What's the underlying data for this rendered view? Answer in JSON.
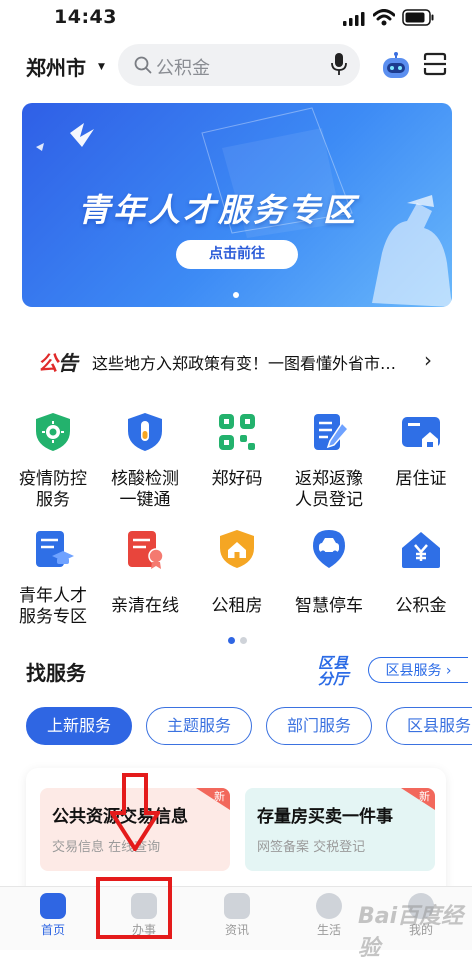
{
  "status_bar": {
    "time": "14:43"
  },
  "header": {
    "city": "郑州市",
    "search_placeholder": "公积金"
  },
  "banner": {
    "title": "青年人才服务专区",
    "button": "点击前往"
  },
  "notice": {
    "tag_a": "公",
    "tag_b": "告",
    "text": "这些地方入郑政策有变！一图看懂外省市…"
  },
  "grid": [
    {
      "line1": "疫情防控",
      "line2": "服务",
      "icon": "virus-shield-icon",
      "color": "#23b26d"
    },
    {
      "line1": "核酸检测",
      "line2": "一键通",
      "icon": "test-tube-shield-icon",
      "color": "#2f6fe6"
    },
    {
      "line1": "郑好码",
      "line2": "",
      "icon": "qr-code-icon",
      "color": "#23b26d"
    },
    {
      "line1": "返郑返豫",
      "line2": "人员登记",
      "icon": "register-pen-icon",
      "color": "#2f6fe6"
    },
    {
      "line1": "居住证",
      "line2": "",
      "icon": "residence-card-icon",
      "color": "#2f6fe6"
    },
    {
      "line1": "青年人才",
      "line2": "服务专区",
      "icon": "graduation-doc-icon",
      "color": "#2f6fe6"
    },
    {
      "line1": "亲清在线",
      "line2": "",
      "icon": "certificate-icon",
      "color": "#e8453c"
    },
    {
      "line1": "公租房",
      "line2": "",
      "icon": "house-shield-icon",
      "color": "#f5a623"
    },
    {
      "line1": "智慧停车",
      "line2": "",
      "icon": "car-location-icon",
      "color": "#2f6fe6"
    },
    {
      "line1": "公积金",
      "line2": "",
      "icon": "yuan-house-icon",
      "color": "#2f6fe6"
    }
  ],
  "services": {
    "title": "找服务",
    "district_logo_a": "区县",
    "district_logo_b": "分厅",
    "district_link": "区县服务 ›",
    "chips": [
      "上新服务",
      "主题服务",
      "部门服务",
      "区县服务"
    ],
    "cards": [
      {
        "title": "公共资源交易信息",
        "sub": "交易信息 在线查询",
        "badge": "新"
      },
      {
        "title": "存量房买卖一件事",
        "sub": "网签备案 交税登记",
        "badge": "新"
      }
    ]
  },
  "tabs": [
    {
      "label": "首页",
      "icon": "home-icon"
    },
    {
      "label": "办事",
      "icon": "clock-icon"
    },
    {
      "label": "资讯",
      "icon": "news-icon"
    },
    {
      "label": "生活",
      "icon": "heart-icon"
    },
    {
      "label": "我的",
      "icon": "user-icon"
    }
  ],
  "watermark": "Bai百度经验",
  "colors": {
    "accent": "#2f66e3",
    "annotation_red": "#e41b1b"
  }
}
